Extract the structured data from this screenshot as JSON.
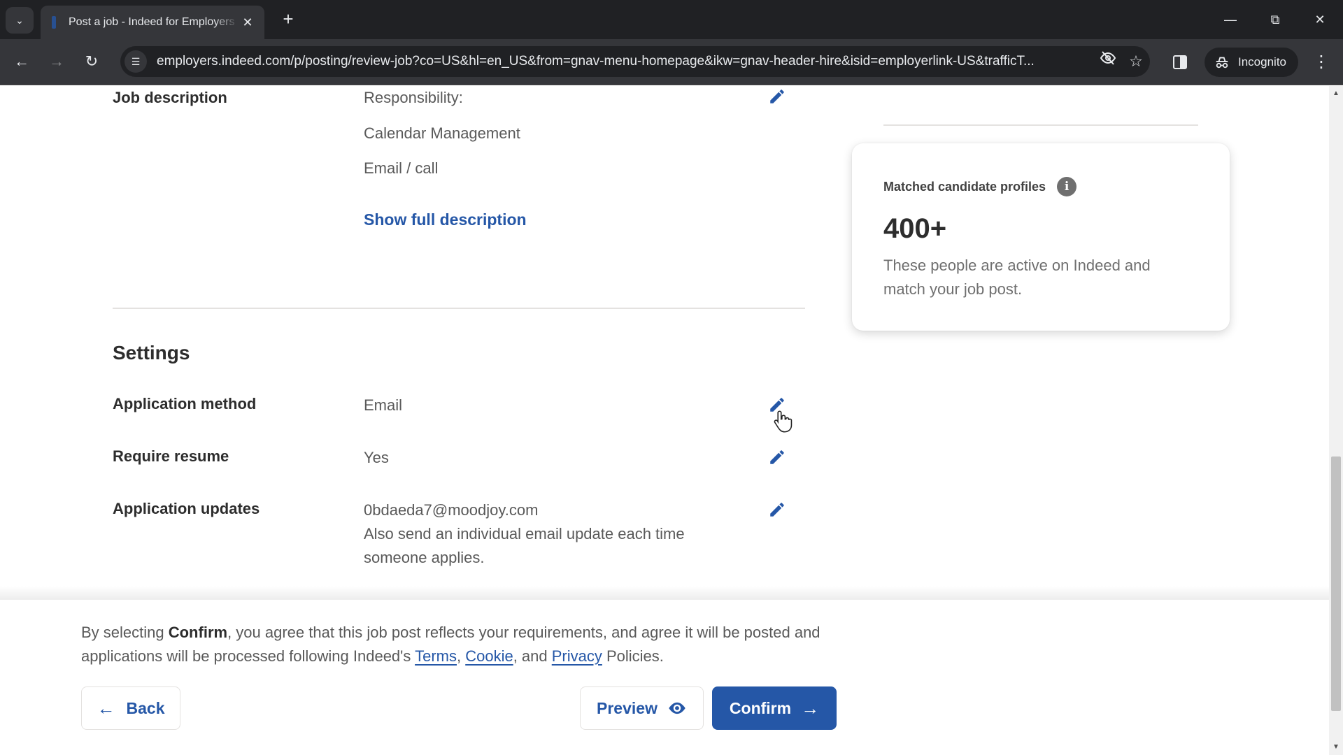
{
  "browser": {
    "tab_title": "Post a job - Indeed for Employers",
    "url": "employers.indeed.com/p/posting/review-job?co=US&hl=en_US&from=gnav-menu-homepage&ikw=gnav-header-hire&isid=employerlink-US&trafficT...",
    "incognito_label": "Incognito",
    "icons": {
      "tab_search": "chevron-down-icon",
      "close_tab": "close-icon",
      "new_tab": "plus-icon",
      "back": "arrow-left-icon",
      "forward": "arrow-right-icon",
      "reload": "reload-icon",
      "site_info": "tune-icon",
      "tracking": "eye-off-icon",
      "bookmark": "star-icon",
      "side_panel": "side-panel-icon",
      "incognito": "incognito-icon",
      "menu": "kebab-menu-icon"
    }
  },
  "job_description": {
    "label": "Job description",
    "lines": [
      "Responsibility:",
      "Calendar Management",
      "Email / call"
    ],
    "show_full_label": "Show full description"
  },
  "settings": {
    "title": "Settings",
    "rows": [
      {
        "label": "Application method",
        "value": "Email"
      },
      {
        "label": "Require resume",
        "value": "Yes"
      },
      {
        "label": "Application updates",
        "value": "0bdaeda7@moodjoy.com",
        "note": "Also send an individual email update each time someone applies."
      }
    ]
  },
  "matched_card": {
    "title": "Matched candidate profiles",
    "count": "400+",
    "description": "These people are active on Indeed and match your job post."
  },
  "footer": {
    "consent_prefix": "By selecting ",
    "consent_bold": "Confirm",
    "consent_middle": ", you agree that this job post reflects your requirements, and agree it will be posted and applications will be processed following Indeed's ",
    "link_terms": "Terms",
    "sep1": ", ",
    "link_cookie": "Cookie",
    "sep2": ", and ",
    "link_privacy": "Privacy",
    "consent_suffix": " Policies.",
    "back_label": "Back",
    "preview_label": "Preview",
    "confirm_label": "Confirm"
  },
  "colors": {
    "brand_blue": "#2557a7",
    "text_dark": "#2d2d2d",
    "text_muted": "#595959"
  }
}
